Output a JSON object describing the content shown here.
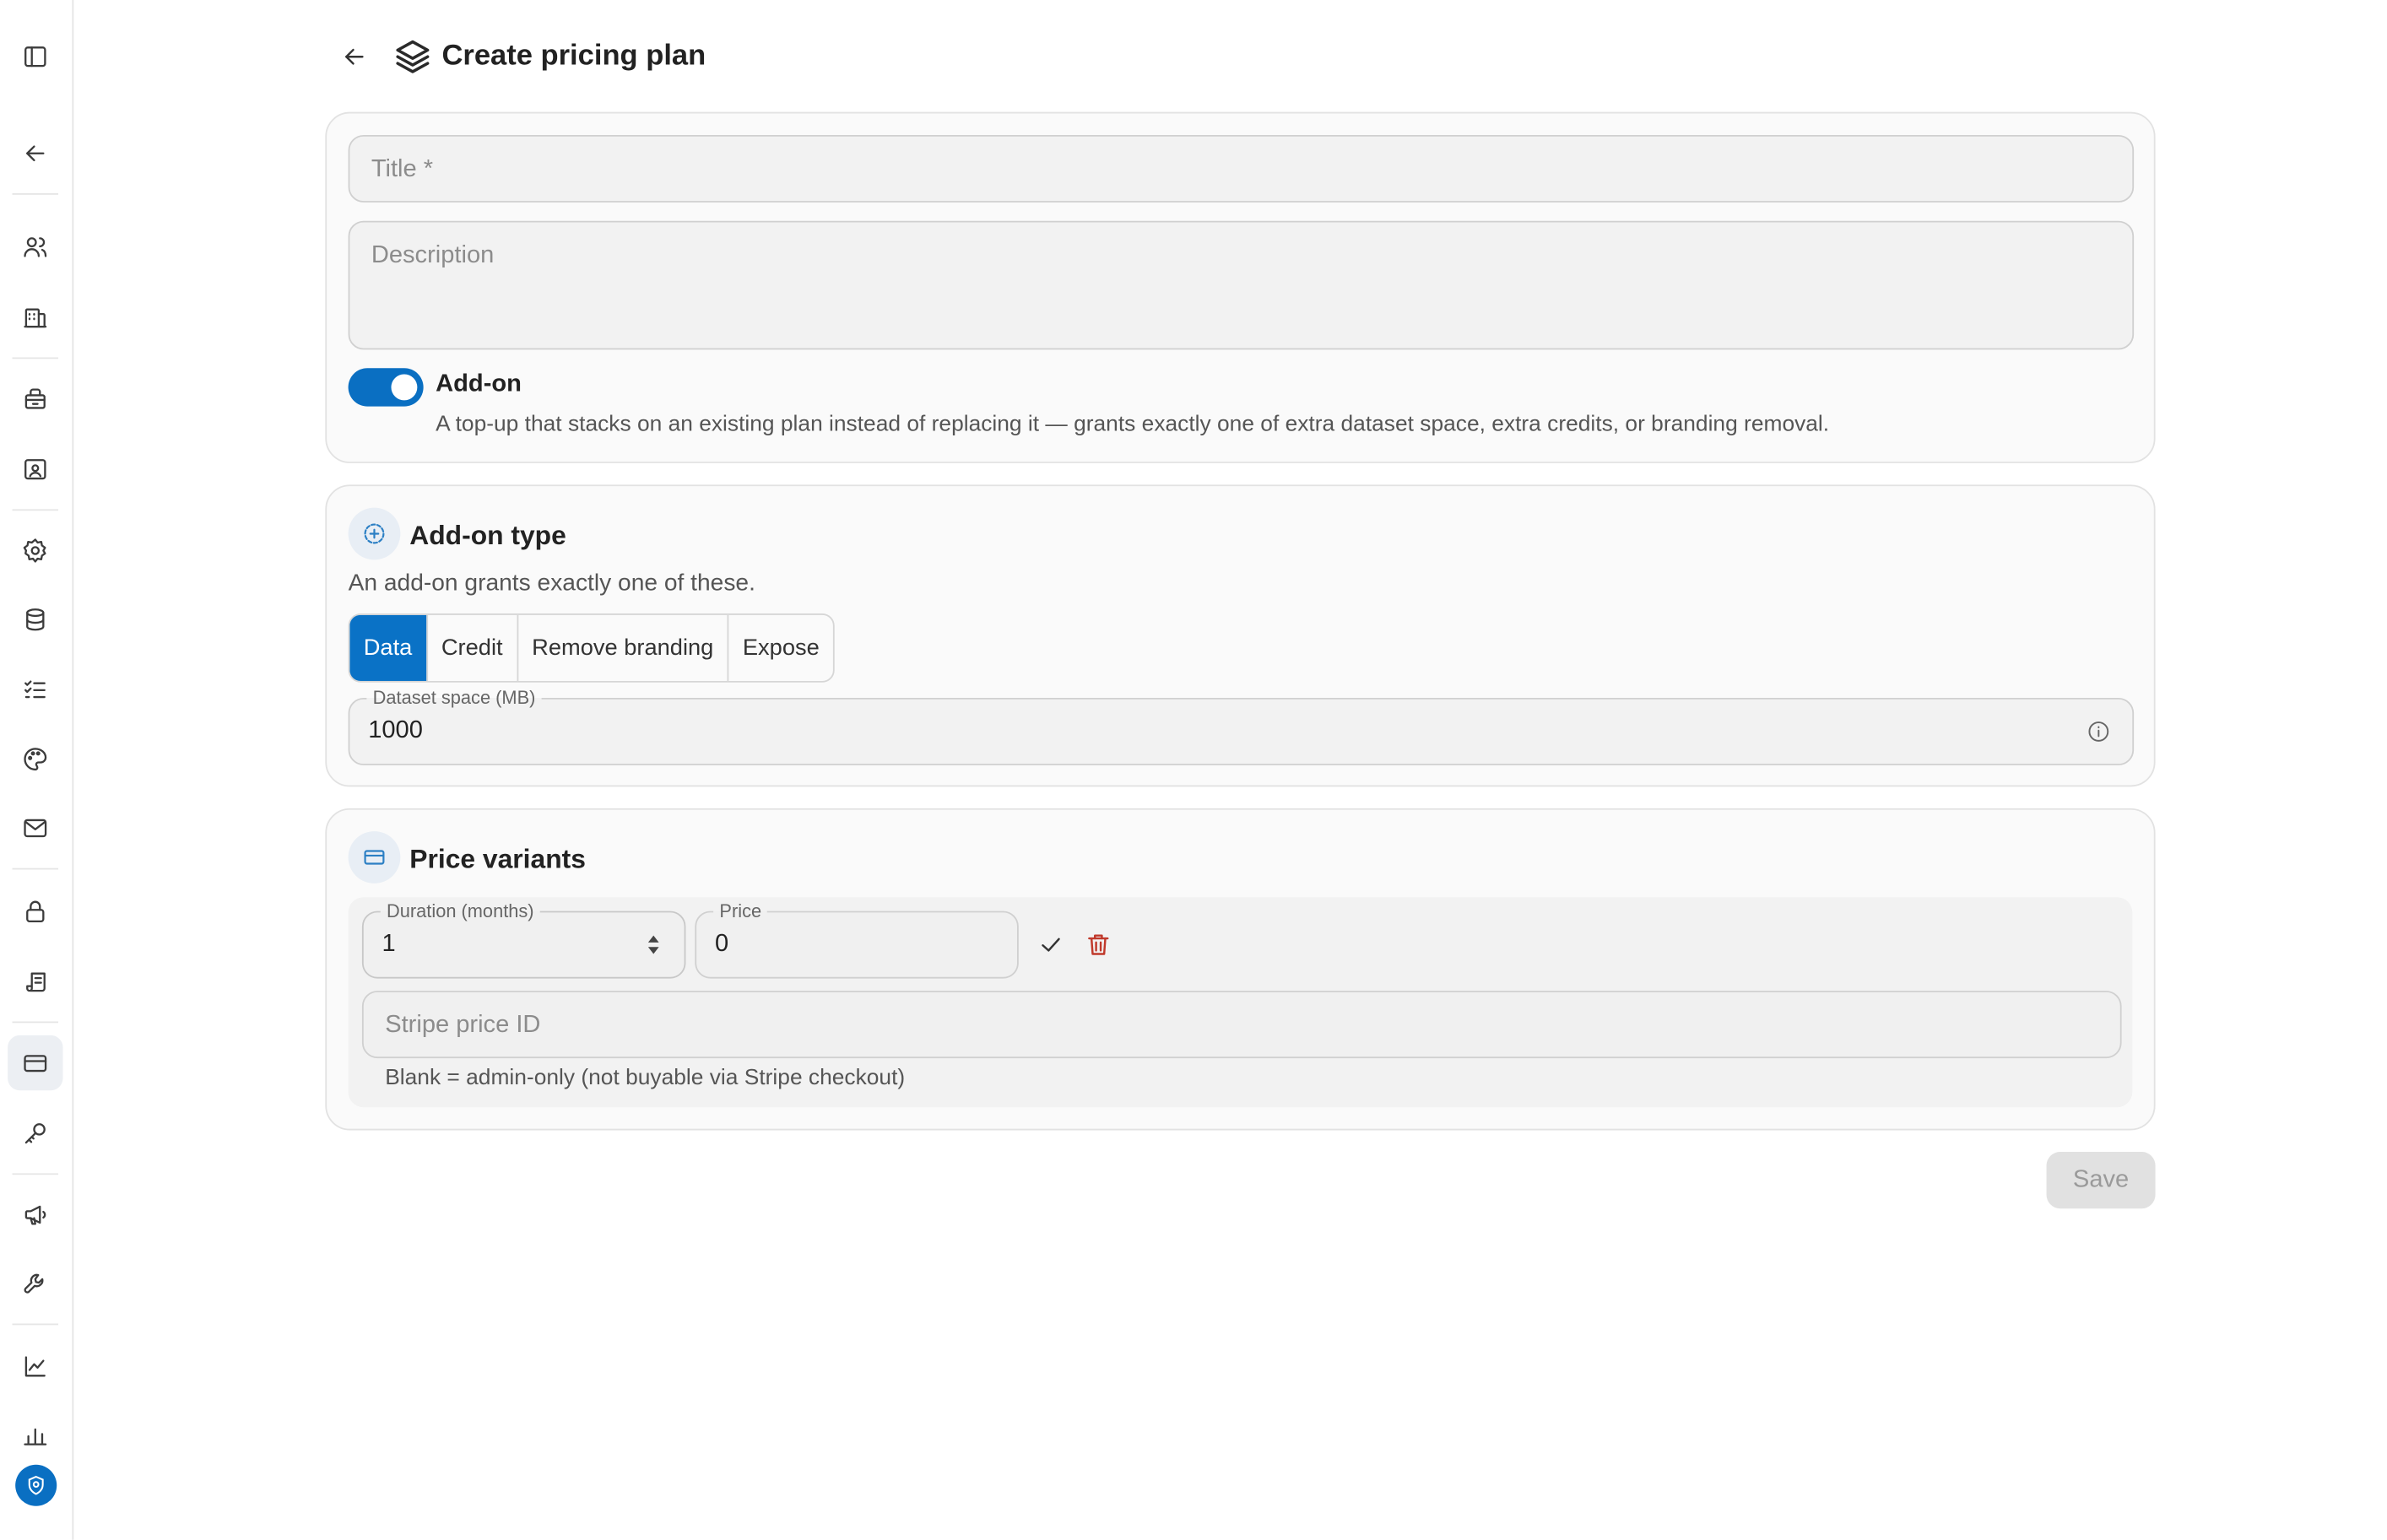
{
  "header": {
    "title": "Create pricing plan"
  },
  "plan": {
    "title_placeholder": "Title *",
    "description_placeholder": "Description",
    "addon_toggle": {
      "label": "Add-on",
      "enabled": true,
      "hint": "A top-up that stacks on an existing plan instead of replacing it — grants exactly one of extra dataset space, extra credits, or branding removal."
    }
  },
  "addon_type": {
    "title": "Add-on type",
    "hint": "An add-on grants exactly one of these.",
    "options": [
      "Data",
      "Credit",
      "Remove branding",
      "Expose"
    ],
    "selected": "Data",
    "field_label": "Dataset space (MB)",
    "field_value": "1000"
  },
  "price_variants": {
    "title": "Price variants",
    "duration_label": "Duration (months)",
    "duration_value": "1",
    "price_label": "Price",
    "price_value": "0",
    "stripe_placeholder": "Stripe price ID",
    "stripe_hint": "Blank = admin-only (not buyable via Stripe checkout)"
  },
  "actions": {
    "save_label": "Save"
  },
  "colors": {
    "accent": "#0a72c6",
    "danger": "#c0392b",
    "disabled_bg": "#e1e1e1"
  }
}
